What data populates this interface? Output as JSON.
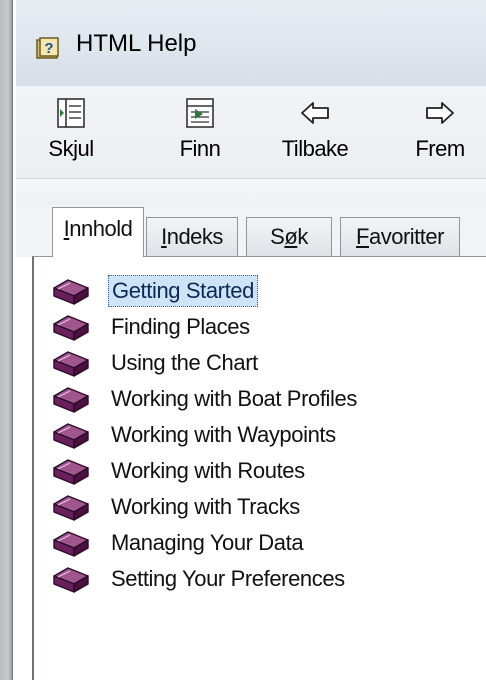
{
  "window": {
    "title": "HTML Help"
  },
  "toolbar": {
    "buttons": [
      {
        "label": "Skjul",
        "icon": "hide-icon"
      },
      {
        "label": "Finn",
        "icon": "locate-icon"
      },
      {
        "label": "Tilbake",
        "icon": "back-arrow-icon"
      },
      {
        "label": "Frem",
        "icon": "forward-arrow-icon"
      }
    ]
  },
  "tabs": [
    {
      "label": "Innhold",
      "underline": "I",
      "rest": "nnhold",
      "active": true
    },
    {
      "label": "Indeks",
      "underline": "I",
      "rest": "ndeks",
      "active": false
    },
    {
      "label": "Søk",
      "pre": "S",
      "underline": "ø",
      "rest": "k",
      "active": false
    },
    {
      "label": "Favoritter",
      "underline": "F",
      "rest": "avoritter",
      "active": false
    }
  ],
  "toc": {
    "items": [
      {
        "label": "Getting Started",
        "selected": true
      },
      {
        "label": "Finding Places"
      },
      {
        "label": "Using the Chart"
      },
      {
        "label": "Working with Boat Profiles"
      },
      {
        "label": "Working with Waypoints"
      },
      {
        "label": "Working with Routes"
      },
      {
        "label": "Working with Tracks"
      },
      {
        "label": "Managing Your Data"
      },
      {
        "label": "Setting Your Preferences"
      }
    ]
  },
  "colors": {
    "book": "#6b1f5e",
    "selection_bg": "#cfe3f7",
    "selection_border": "#2b5f94"
  }
}
